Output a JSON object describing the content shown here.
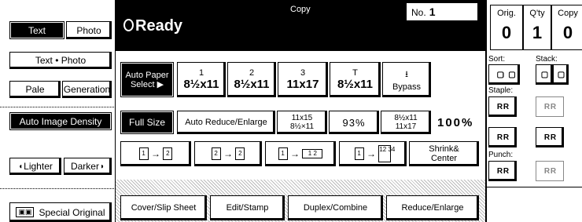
{
  "left": {
    "text": "Text",
    "photo": "Photo",
    "text_photo": "Text • Photo",
    "pale": "Pale",
    "generation": "Generation",
    "auto_image_density": "Auto Image Density",
    "lighter": "Lighter",
    "darker": "Darker",
    "special_original": "Special Original"
  },
  "top": {
    "status": "Ready",
    "mode": "Copy",
    "no_label": "No.",
    "no_value": "1"
  },
  "paper": {
    "auto_paper_select": "Auto Paper Select ▶",
    "trays": [
      {
        "num": "1",
        "size": "8½x11"
      },
      {
        "num": "2",
        "size": "8½x11"
      },
      {
        "num": "3",
        "size": "11x17"
      },
      {
        "num": "T",
        "size": "8½x11"
      }
    ],
    "bypass": "Bypass"
  },
  "ratio": {
    "full_size": "Full Size",
    "auto_reduce_enlarge": "Auto Reduce/Enlarge",
    "preset1_a": "11x15",
    "preset1_b": "8½×11",
    "preset2": "93%",
    "preset3_a": "8½x11",
    "preset3_b": "11x17",
    "current": "100%"
  },
  "duplex": {
    "shrink_center": "Shrink& Center"
  },
  "tabs": [
    "Cover/Slip Sheet",
    "Edit/Stamp",
    "Duplex/Combine",
    "Reduce/Enlarge"
  ],
  "right": {
    "orig_label": "Orig.",
    "orig_value": "0",
    "qty_label": "Q'ty",
    "qty_value": "1",
    "copy_label": "Copy",
    "copy_value": "0",
    "sort": "Sort:",
    "stack": "Stack:",
    "staple": "Staple:",
    "punch": "Punch:"
  }
}
